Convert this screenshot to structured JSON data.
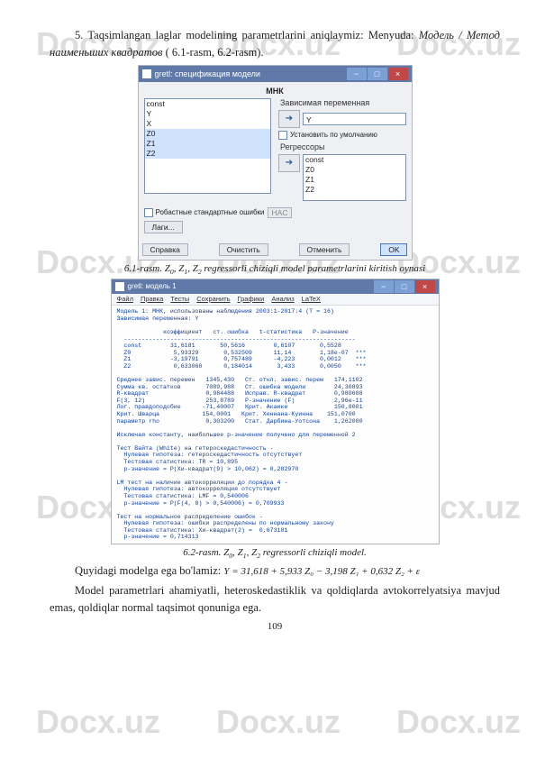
{
  "watermark": "Docx.uz",
  "para_intro": "5.  Taqsimlangan laglar modelining parametrlarini aniqlaymiz: Menyuda: ",
  "para_intro2": "Модель / Метод наименьших квадратов",
  "para_intro3": " ( 6.1-rasm, 6.2-rasm).",
  "dialog1": {
    "title": "gretl: спецификация модели",
    "section_mnk": "МНК",
    "section_zav": "Зависимая переменная",
    "zav_value": "Y",
    "po_umolch": "Установить по умолчанию",
    "section_reg": "Регрессоры",
    "left_items": [
      "const",
      "Y",
      "X",
      "Z0",
      "Z1",
      "Z2"
    ],
    "right_items": [
      "const",
      "Z0",
      "Z1",
      "Z2"
    ],
    "robust": "Робастные стандартные ошибки",
    "hac_btn": "HAC",
    "lags_btn": "Лаги...",
    "help_btn": "Справка",
    "clear_btn": "Очистить",
    "cancel_btn": "Отменить",
    "ok_btn": "OK"
  },
  "caption1_pre": "6.1-rasm. ",
  "caption1_z": "Z",
  "caption1_sub0": "0",
  "caption1_sub1": "1",
  "caption1_sub2": "2",
  "caption1_post": " regressorli chiziqli model parametrlarini kiritish oynasi",
  "dialog2": {
    "title": "gretl: модель 1",
    "menu": [
      "Файл",
      "Правка",
      "Тесты",
      "Сохранить",
      "Графики",
      "Анализ",
      "LaTeX"
    ],
    "body": "Модель 1: МНК, использованы наблюдения 2003:1-2017:4 (T = 16)\nЗависимая переменная: Y\n\n             коэффициент   ст. ошибка   t-статистика   P-значение\n  -----------------------------------------------------------------\n  const        31,6181       50,5616        0,6107       0,5528\n  Z0            5,93329       0,532509      11,14        1,18e-07  ***\n  Z1           -3,19791       0,757489      -4,223       0,0012    ***\n  Z2            0,633060      0,184014       3,433       0,0050    ***\n\nСреднее завис. перемен   1345,430   Ст. откл. завис. перем   174,1102\nСумма кв. остатков       7089,988   Ст. ошибка модели        24,30893\nR-квадрат                0,984488   Исправ. R-квадрат        0,980608\nF(3, 12)                 253,8789   Р-значение (F)           2,96e-11\nЛог. правдоподобие      -71,40007   Крит. Акаике             150,8001\nКрит. Шварца            154,0001   Крит. Хеннана-Куинна    151,0700\nпараметр rho             0,303200   Стат. Дарбина-Уотсона    1,262000\n\nИсключая константу, наибольшее р-значение получено для переменной 2\n\nТест Вайта (White) на гетероскедастичность -\n  Нулевая гипотеза: гетероскедастичность отсутствует\n  Тестовая статистика: TR = 10,895\n  р-значение = P(Хи-квадрат(9) > 10,062) = 0,282970\n\nLM тест на наличие автокорреляции до порядка 4 -\n  Нулевая гипотеза: автокорреляция отсутствует\n  Тестовая статистика: LMF = 0,540006\n  р-значение = P(F(4, 8) > 0,540006) = 0,709933\n\nТест на нормальное распределение ошибок -\n  Нулевая гипотеза: ошибки распределены по нормальному закону\n  Тестовая статистика: Хи-квадрат(2) =  0,673181\n  р-значение = 0,714313"
  },
  "caption2_pre": "6.2-rasm. ",
  "caption2_post": " regressorli chiziqli model.",
  "para_quyidagi": "Quyidagi modelga ega bо'lamiz: ",
  "formula": "Y = 31,618 + 5,933 Z₀ − 3,198 Z₁ + 0,632 Z₂ + ε",
  "para_model": "Model parametrlari ahamiyatli, heteroskedastiklik va qoldiqlarda avtokorrelyatsiya mavjud emas, qoldiqlar normal taqsimot qonuniga ega.",
  "pagenum": "109"
}
